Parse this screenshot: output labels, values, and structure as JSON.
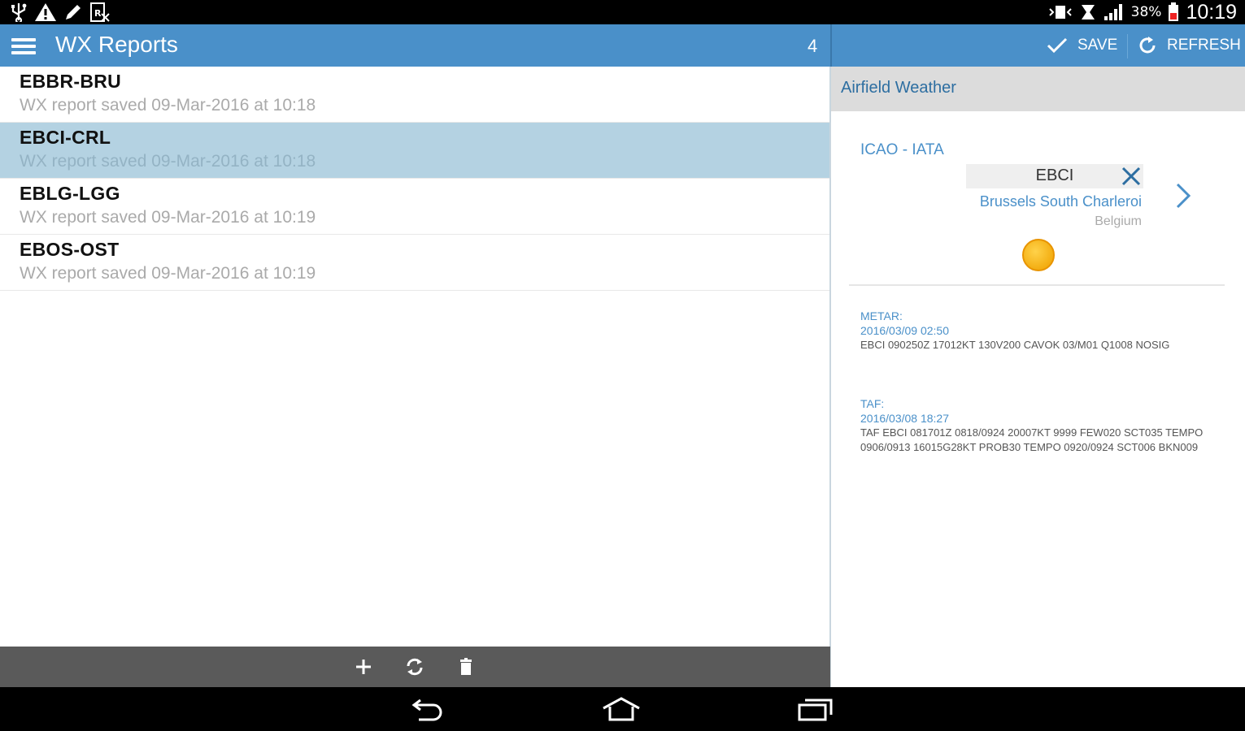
{
  "status_bar": {
    "battery_percent": "38%",
    "time": "10:19",
    "icons": [
      "usb-icon",
      "warning-icon",
      "pen-icon",
      "prescription-icon",
      "vibrate-icon",
      "alarm-icon",
      "signal-icon",
      "battery-icon"
    ]
  },
  "action_bar": {
    "title": "WX Reports",
    "count": "4",
    "save_label": "SAVE",
    "refresh_label": "REFRESH",
    "color": "#4a90c9"
  },
  "reports": [
    {
      "code": "EBBR-BRU",
      "subtitle": "WX report saved 09-Mar-2016 at 10:18",
      "selected": false
    },
    {
      "code": "EBCI-CRL",
      "subtitle": "WX report saved 09-Mar-2016 at 10:18",
      "selected": true
    },
    {
      "code": "EBLG-LGG",
      "subtitle": "WX report saved 09-Mar-2016 at 10:19",
      "selected": false
    },
    {
      "code": "EBOS-OST",
      "subtitle": "WX report saved 09-Mar-2016 at 10:19",
      "selected": false
    }
  ],
  "detail": {
    "section_title": "Airfield Weather",
    "icao_label": "ICAO - IATA",
    "icao_value": "EBCI",
    "airport_name": "Brussels South Charleroi",
    "country": "Belgium",
    "weather_icon": "sun-icon",
    "metar": {
      "label": "METAR:",
      "date": "2016/03/09 02:50",
      "text": "EBCI 090250Z 17012KT 130V200 CAVOK 03/M01 Q1008 NOSIG"
    },
    "taf": {
      "label": "TAF:",
      "date": "2016/03/08 18:27",
      "text": "TAF EBCI 081701Z 0818/0924 20007KT 9999 FEW020 SCT035 TEMPO 0906/0913 16015G28KT PROB30 TEMPO 0920/0924 SCT006 BKN009"
    }
  },
  "toolbar_icons": [
    "add-icon",
    "sync-icon",
    "trash-icon"
  ],
  "nav_icons": [
    "back-icon",
    "home-icon",
    "recent-apps-icon"
  ]
}
